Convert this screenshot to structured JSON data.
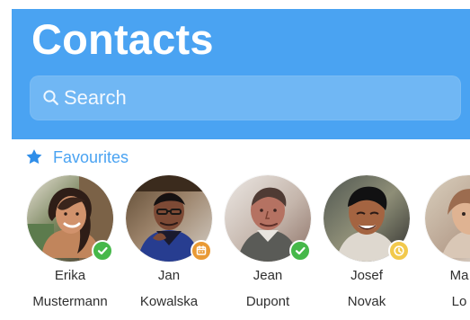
{
  "header": {
    "title": "Contacts",
    "background": "#4aa3f2"
  },
  "search": {
    "placeholder": "Search",
    "value": "",
    "icon": "search-icon"
  },
  "favourites": {
    "label": "Favourites",
    "icon": "star-icon",
    "accent": "#4aa3f2"
  },
  "contacts": [
    {
      "first_name": "Erika",
      "last_name": "Mustermann",
      "status": "available",
      "status_icon": "check-icon",
      "status_color": "#46b84a"
    },
    {
      "first_name": "Jan",
      "last_name": "Kowalska",
      "status": "busy",
      "status_icon": "calendar-icon",
      "status_color": "#e99a35"
    },
    {
      "first_name": "Jean",
      "last_name": "Dupont",
      "status": "available",
      "status_icon": "check-icon",
      "status_color": "#46b84a"
    },
    {
      "first_name": "Josef",
      "last_name": "Novak",
      "status": "away",
      "status_icon": "clock-icon",
      "status_color": "#f2c94c"
    },
    {
      "first_name": "Ma",
      "last_name": "Lo",
      "status": "",
      "status_icon": "",
      "status_color": ""
    }
  ]
}
